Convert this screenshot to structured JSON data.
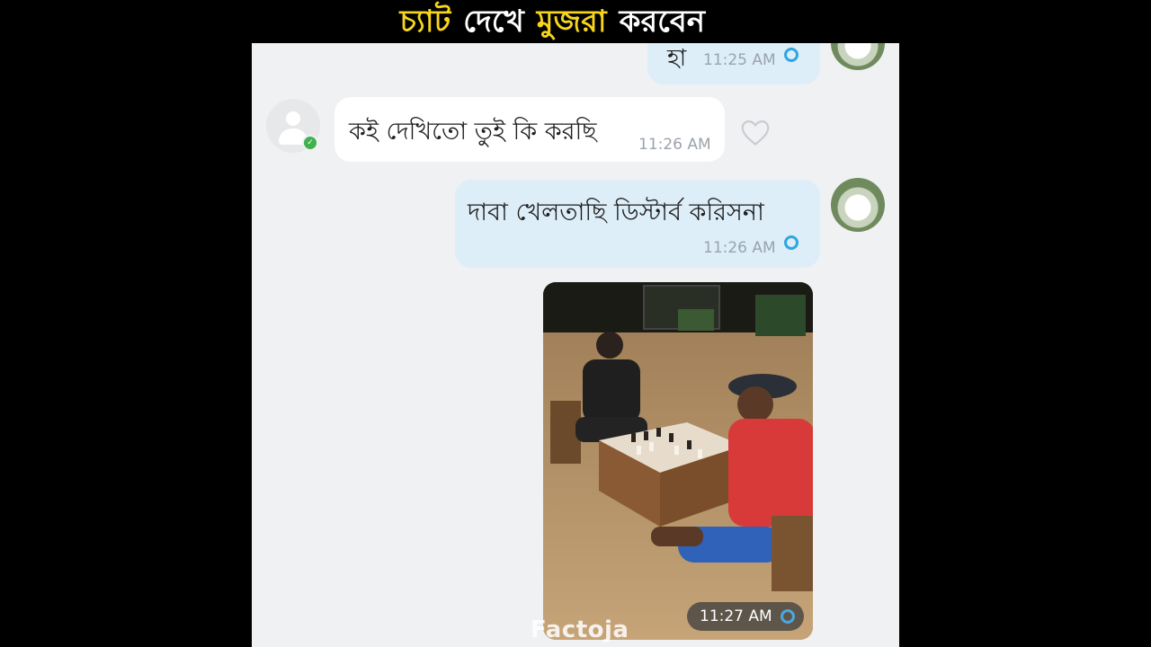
{
  "header": {
    "words": [
      {
        "text": "চ্যাট",
        "color": "#f7d51d"
      },
      {
        "text": "দেখে",
        "color": "#ffffff"
      },
      {
        "text": "মুজরা",
        "color": "#f7d51d"
      },
      {
        "text": "করবেন",
        "color": "#ffffff"
      }
    ],
    "emoji": "😂"
  },
  "messages": [
    {
      "id": "m0",
      "direction": "outgoing",
      "text_partial": "হা",
      "time": "11:25 AM",
      "status": "seen"
    },
    {
      "id": "m1",
      "direction": "incoming",
      "text": "কই দেখিতো তুই কি করছি",
      "time": "11:26 AM",
      "reaction_icon": "heart-outline-icon"
    },
    {
      "id": "m2",
      "direction": "outgoing",
      "text": "দাবা খেলতাছি ডিস্টার্ব করিসনা",
      "time": "11:26 AM",
      "status": "seen"
    },
    {
      "id": "m3",
      "direction": "outgoing",
      "type": "photo",
      "photo_subject": "two people playing chess on a flooded floor",
      "time": "11:27 AM",
      "status": "seen"
    }
  ],
  "watermark": "Factoja",
  "colors": {
    "outgoing_bubble": "#ddeef9",
    "incoming_bubble": "#ffffff",
    "chat_background": "#f0f1f3",
    "seen_indicator": "#2ea7e0",
    "online_indicator": "#3fb24f"
  }
}
